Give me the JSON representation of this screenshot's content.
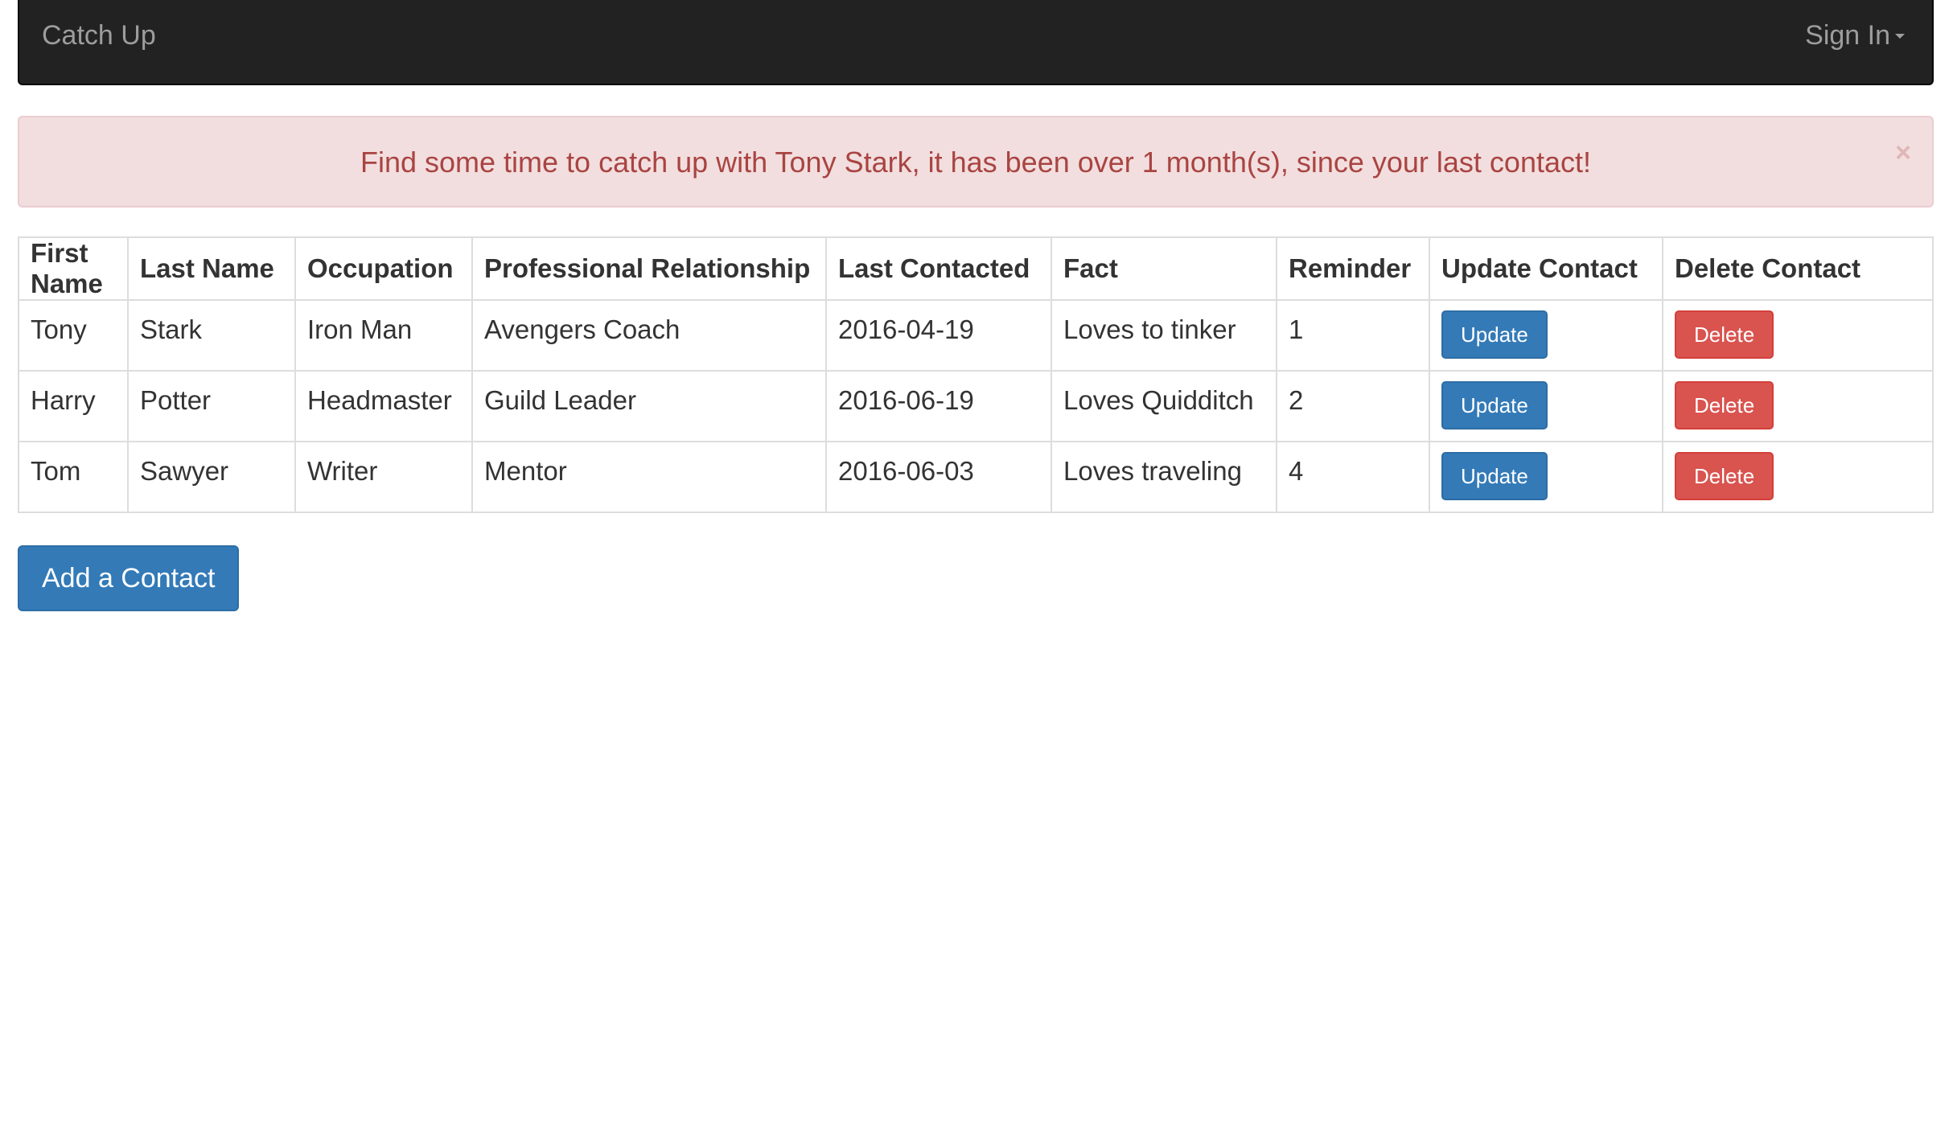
{
  "navbar": {
    "brand": "Catch Up",
    "signin_label": "Sign In"
  },
  "alert": {
    "message": "Find some time to catch up with Tony Stark, it has been over 1 month(s), since your last contact!",
    "close_glyph": "×"
  },
  "table": {
    "headers": [
      "First Name",
      "Last Name",
      "Occupation",
      "Professional Relationship",
      "Last Contacted",
      "Fact",
      "Reminder",
      "Update Contact",
      "Delete Contact"
    ],
    "rows": [
      {
        "first": "Tony",
        "last": "Stark",
        "occupation": "Iron Man",
        "relationship": "Avengers Coach",
        "last_contacted": "2016-04-19",
        "fact": "Loves to tinker",
        "reminder": "1",
        "update_label": "Update",
        "delete_label": "Delete"
      },
      {
        "first": "Harry",
        "last": "Potter",
        "occupation": "Headmaster",
        "relationship": "Guild Leader",
        "last_contacted": "2016-06-19",
        "fact": "Loves Quidditch",
        "reminder": "2",
        "update_label": "Update",
        "delete_label": "Delete"
      },
      {
        "first": "Tom",
        "last": "Sawyer",
        "occupation": "Writer",
        "relationship": "Mentor",
        "last_contacted": "2016-06-03",
        "fact": "Loves traveling",
        "reminder": "4",
        "update_label": "Update",
        "delete_label": "Delete"
      }
    ]
  },
  "add_button_label": "Add a Contact",
  "colors": {
    "navbar_bg": "#222222",
    "navbar_text": "#9d9d9d",
    "alert_bg": "#f2dede",
    "alert_text": "#a94442",
    "primary": "#337ab7",
    "danger": "#d9534f"
  }
}
